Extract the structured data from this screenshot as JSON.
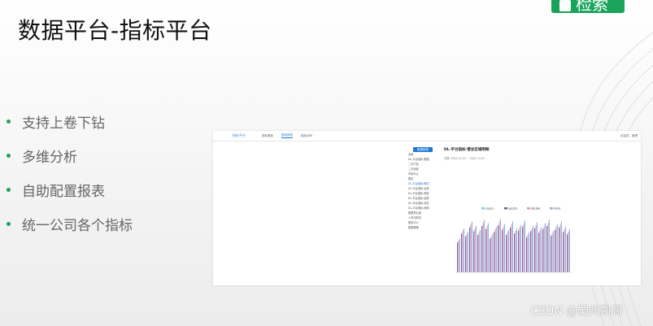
{
  "header": {
    "green_button": "检索"
  },
  "slide": {
    "title": "数据平台-指标平台",
    "bullets": [
      "支持上卷下钻",
      "多维分析",
      "自助配置报表",
      "统一公司各个指标"
    ]
  },
  "watermark": "CSDN @蜀州凯哥",
  "screenshot": {
    "logo": "指标平台",
    "nav": [
      "指标看板",
      "指标报表",
      "指标百科"
    ],
    "user": "欢迎您，管理",
    "side_button": "新建报表",
    "side_items": [
      "全部",
      "DL-平台指标-数据",
      "二手产品",
      "二手运营",
      "市场中心",
      "服务",
      "DL-平台指标-概况",
      "DL-平台指标-运营",
      "DL-平台指标-销售",
      "DL-平台指标-结算",
      "DL-平台指标-收支",
      "DL-平台指标-转换",
      "数据事业部",
      "人事与财务",
      "服务中心",
      "数据策略"
    ],
    "report_title": "DL-平台指标-营业区域明细",
    "date_label": "日期",
    "date_from": "2021-11-01",
    "date_to": "2021-11-07",
    "legend": [
      "营业收入",
      "运营成本",
      "销售费用",
      "利润率"
    ]
  },
  "colors": {
    "brand_green": "#1aa35a",
    "accent_blue": "#1e7ad0"
  }
}
